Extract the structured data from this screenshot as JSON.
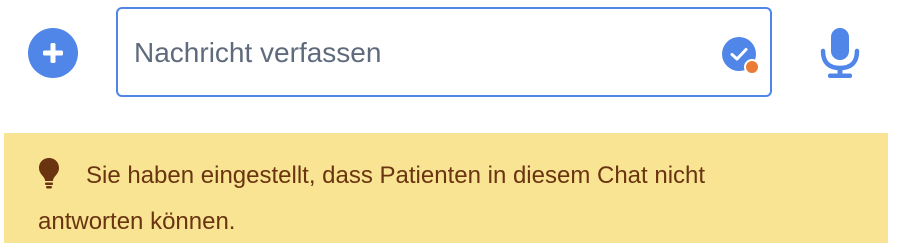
{
  "composer": {
    "add_icon": "plus-circle-icon",
    "message_placeholder": "Nachricht verfassen",
    "message_value": "",
    "check_icon": "check-badge-icon",
    "mic_icon": "microphone-icon",
    "accent_color": "#4f86e8",
    "status_dot_color": "#ea7a35"
  },
  "banner": {
    "icon": "lightbulb-icon",
    "text": "Sie haben eingestellt, dass Patienten in diesem Chat nicht antworten können.",
    "background_color": "#f8e492",
    "text_color": "#6a3410"
  }
}
